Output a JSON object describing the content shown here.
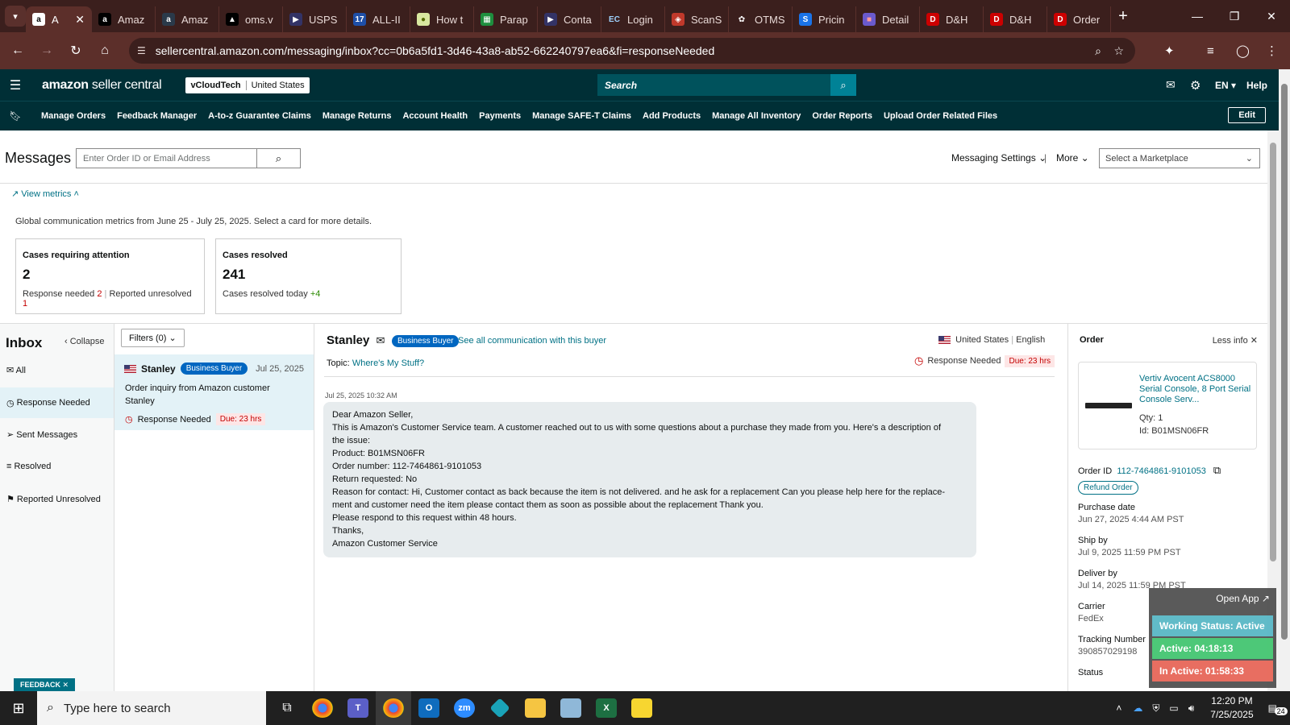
{
  "browser": {
    "tabs": [
      {
        "label": "A",
        "icon": "a",
        "icon_bg": "#ffffff",
        "icon_fg": "#000000",
        "active": true
      },
      {
        "label": "Amaz",
        "icon": "a",
        "icon_bg": "#000000",
        "icon_fg": "#ffffff"
      },
      {
        "label": "Amaz",
        "icon": "a",
        "icon_bg": "#2a3a4a",
        "icon_fg": "#ffffff"
      },
      {
        "label": "oms.v",
        "icon": "▲",
        "icon_bg": "#000000",
        "icon_fg": "#ffffff"
      },
      {
        "label": "USPS",
        "icon": "▶",
        "icon_bg": "#333366",
        "icon_fg": "#ffffff"
      },
      {
        "label": "ALL-II",
        "icon": "17",
        "icon_bg": "#1e4fa8",
        "icon_fg": "#ffffff"
      },
      {
        "label": "How t",
        "icon": "●",
        "icon_bg": "#d9e8a0",
        "icon_fg": "#556b00"
      },
      {
        "label": "Parap",
        "icon": "▦",
        "icon_bg": "#1e8e3e",
        "icon_fg": "#ffffff"
      },
      {
        "label": "Conta",
        "icon": "▶",
        "icon_bg": "#333366",
        "icon_fg": "#ffffff"
      },
      {
        "label": "Login",
        "icon": "EC",
        "icon_bg": "#3b1f1d",
        "icon_fg": "#9fd3ff"
      },
      {
        "label": "ScanS",
        "icon": "◈",
        "icon_bg": "#c0392b",
        "icon_fg": "#ffffff"
      },
      {
        "label": "OTMS",
        "icon": "✿",
        "icon_bg": "#3b1f1d",
        "icon_fg": "#ffffff"
      },
      {
        "label": "Pricin",
        "icon": "S",
        "icon_bg": "#1a73e8",
        "icon_fg": "#ffffff"
      },
      {
        "label": "Detail",
        "icon": "■",
        "icon_bg": "#6a5acd",
        "icon_fg": "#ff9999"
      },
      {
        "label": "D&H",
        "icon": "D",
        "icon_bg": "#cc0000",
        "icon_fg": "#ffffff"
      },
      {
        "label": "D&H",
        "icon": "D",
        "icon_bg": "#cc0000",
        "icon_fg": "#ffffff"
      },
      {
        "label": "Order",
        "icon": "D",
        "icon_bg": "#cc0000",
        "icon_fg": "#ffffff"
      }
    ],
    "url": "sellercentral.amazon.com/messaging/inbox?cc=0b6a5fd1-3d46-43a8-ab52-662240797ea6&fi=responseNeeded"
  },
  "header": {
    "logo_bold": "amazon",
    "logo_light": " seller central",
    "store": "vCloudTech",
    "country": "United States",
    "search_placeholder": "Search",
    "lang": "EN",
    "help": "Help"
  },
  "nav": {
    "links": [
      "Manage Orders",
      "Feedback Manager",
      "A-to-z Guarantee Claims",
      "Manage Returns",
      "Account Health",
      "Payments",
      "Manage SAFE-T Claims",
      "Add Products",
      "Manage All Inventory",
      "Order Reports",
      "Upload Order Related Files"
    ],
    "edit": "Edit"
  },
  "messages": {
    "title": "Messages",
    "search_placeholder": "Enter Order ID or Email Address",
    "settings": "Messaging Settings",
    "more": "More",
    "marketplace_placeholder": "Select a Marketplace"
  },
  "metrics": {
    "toggle": "View metrics",
    "note": "Global communication metrics from June 25 - July 25, 2025. Select a card for more details.",
    "attention": {
      "title": "Cases requiring attention",
      "count": "2",
      "sub_a": "Response needed",
      "sub_a_val": "2",
      "sub_b": "Reported unresolved",
      "sub_b_val": "1"
    },
    "resolved": {
      "title": "Cases resolved",
      "count": "241",
      "sub": "Cases resolved today",
      "sub_val": "+4"
    }
  },
  "inbox": {
    "title": "Inbox",
    "collapse": "Collapse",
    "folders": [
      "All",
      "Response Needed",
      "Sent Messages",
      "Resolved",
      "Reported Unresolved"
    ],
    "filters": "Filters (0)",
    "conversation": {
      "name": "Stanley",
      "badge": "Business Buyer",
      "date": "Jul 25, 2025",
      "subject": "Order inquiry from Amazon customer Stanley",
      "status": "Response Needed",
      "due": "Due: 23 hrs"
    }
  },
  "thread": {
    "buyer": "Stanley",
    "badge": "Business Buyer",
    "see_all": "See all communication with this buyer",
    "topic_label": "Topic:",
    "topic": "Where's My Stuff?",
    "country": "United States",
    "language": "English",
    "status": "Response Needed",
    "due": "Due: 23 hrs",
    "timestamp": "Jul 25, 2025 10:32 AM",
    "body": [
      "Dear Amazon Seller,",
      "This is Amazon's Customer Service team. A customer reached out to us with some questions about a purchase they made from you. Here's a description of",
      "the issue:",
      "Product: B01MSN06FR",
      "Order number: 112-7464861-9101053",
      "Return requested: No",
      "Reason for contact: Hi, Customer contact as back because the item is not delivered. and he ask for a replacement Can you please help here for the replace-",
      "ment and customer need the item please contact them as soon as possible about the replacement Thank you.",
      "Please respond to this request within 48 hours.",
      "Thanks,",
      "Amazon Customer Service"
    ]
  },
  "order": {
    "title": "Order",
    "less_info": "Less info",
    "product_title": "Vertiv Avocent ACS8000 Serial Console, 8 Port Serial Console Serv...",
    "qty": "Qty: 1",
    "id": "Id: B01MSN06FR",
    "order_id_label": "Order ID",
    "order_id": "112-7464861-9101053",
    "refund": "Refund Order",
    "fields": [
      {
        "label": "Purchase date",
        "value": "Jun 27, 2025 4:44 AM PST"
      },
      {
        "label": "Ship by",
        "value": "Jul 9, 2025 11:59 PM PST"
      },
      {
        "label": "Deliver by",
        "value": "Jul 14, 2025 11:59 PM PST"
      },
      {
        "label": "Carrier",
        "value": "FedEx"
      },
      {
        "label": "Tracking Number",
        "value": "390857029198"
      },
      {
        "label": "Status",
        "value": ""
      }
    ]
  },
  "overlay": {
    "open_app": "Open App ↗",
    "working": "Working Status: Active",
    "active": "Active: 04:18:13",
    "inactive": "In Active: 01:58:33",
    "colors": {
      "working": "#5cb9c7",
      "active": "#48c774",
      "inactive": "#e86a5c"
    }
  },
  "feedback": "FEEDBACK ✕",
  "taskbar": {
    "search_placeholder": "Type here to search",
    "time": "12:20 PM",
    "date": "7/25/2025",
    "notifications": "24"
  }
}
